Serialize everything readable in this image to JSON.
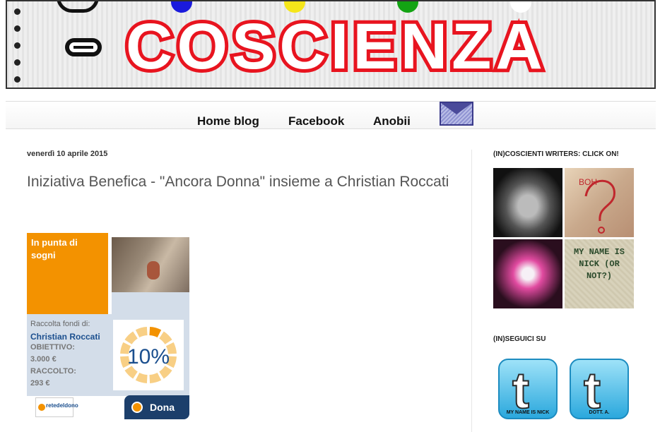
{
  "header": {
    "title": "COSCIENZA",
    "dot_colors": [
      "#1a1adc",
      "#f5e61a",
      "#13a313",
      "#ffffff"
    ]
  },
  "nav": {
    "items": [
      {
        "label": "Home blog"
      },
      {
        "label": "Facebook"
      },
      {
        "label": "Anobii"
      }
    ],
    "mail_icon": "envelope-icon"
  },
  "post": {
    "date": "venerdì 10 aprile 2015",
    "title": "Iniziativa Benefica - \"Ancora Donna\" insieme a Christian Roccati"
  },
  "donation_widget": {
    "campaign": "In punta di sogni",
    "raised_for_label": "Raccolta fondi di:",
    "person": "Christian Roccati",
    "goal_label": "OBIETTIVO:",
    "goal_value": "3.000 €",
    "raised_label": "RACCOLTO:",
    "raised_value": "293 €",
    "percent": "10%",
    "progress_fraction": 0.1,
    "logo_text": "retedeldono",
    "button_label": "Dona",
    "accent": "#f39200",
    "navy": "#1c3f6b"
  },
  "sidebar": {
    "writers_heading": "(IN)COSCIENTI WRITERS: CLICK ON!",
    "tile4_text": "MY NAME IS NICK (OR NOT?)",
    "tile2_text": "BOH",
    "follow_heading": "(IN)SEGUICI SU",
    "twitter": [
      {
        "label": "MY NAME IS NICK"
      },
      {
        "label": "DOTT. A."
      }
    ]
  }
}
